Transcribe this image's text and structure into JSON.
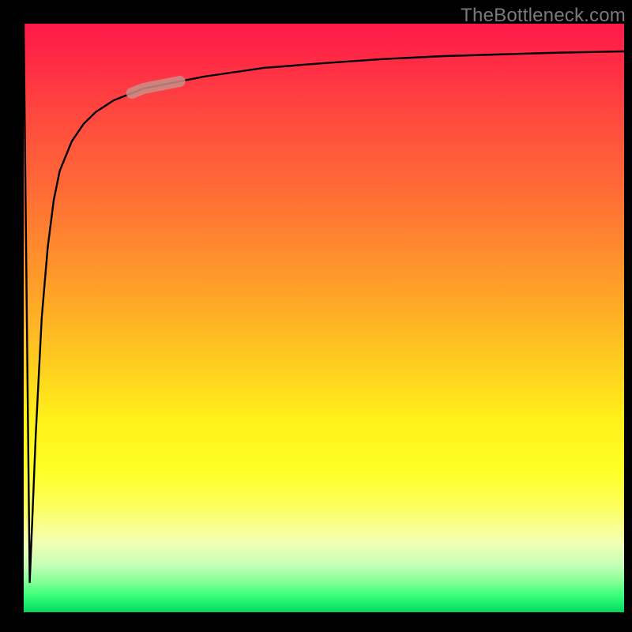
{
  "watermark": {
    "text": "TheBottleneck.com"
  },
  "colors": {
    "curve": "#000000",
    "marker": "#c98f87",
    "gradient_top": "#ff1a49",
    "gradient_bottom": "#0ad060"
  },
  "chart_data": {
    "type": "line",
    "title": "",
    "xlabel": "",
    "ylabel": "",
    "xlim": [
      0,
      100
    ],
    "ylim": [
      0,
      100
    ],
    "grid": false,
    "legend": false,
    "series": [
      {
        "name": "bottleneck-curve",
        "x": [
          0,
          1,
          2,
          3,
          4,
          5,
          6,
          8,
          10,
          12,
          15,
          20,
          25,
          30,
          40,
          50,
          60,
          70,
          80,
          90,
          100
        ],
        "values": [
          100,
          5,
          30,
          50,
          62,
          70,
          75,
          80,
          83,
          85,
          87,
          89,
          90,
          91,
          92.5,
          93.3,
          94,
          94.5,
          94.8,
          95.1,
          95.3
        ]
      }
    ],
    "marker": {
      "on_series": "bottleneck-curve",
      "x_range": [
        18,
        26
      ],
      "note": "highlighted segment at knee of curve"
    }
  }
}
